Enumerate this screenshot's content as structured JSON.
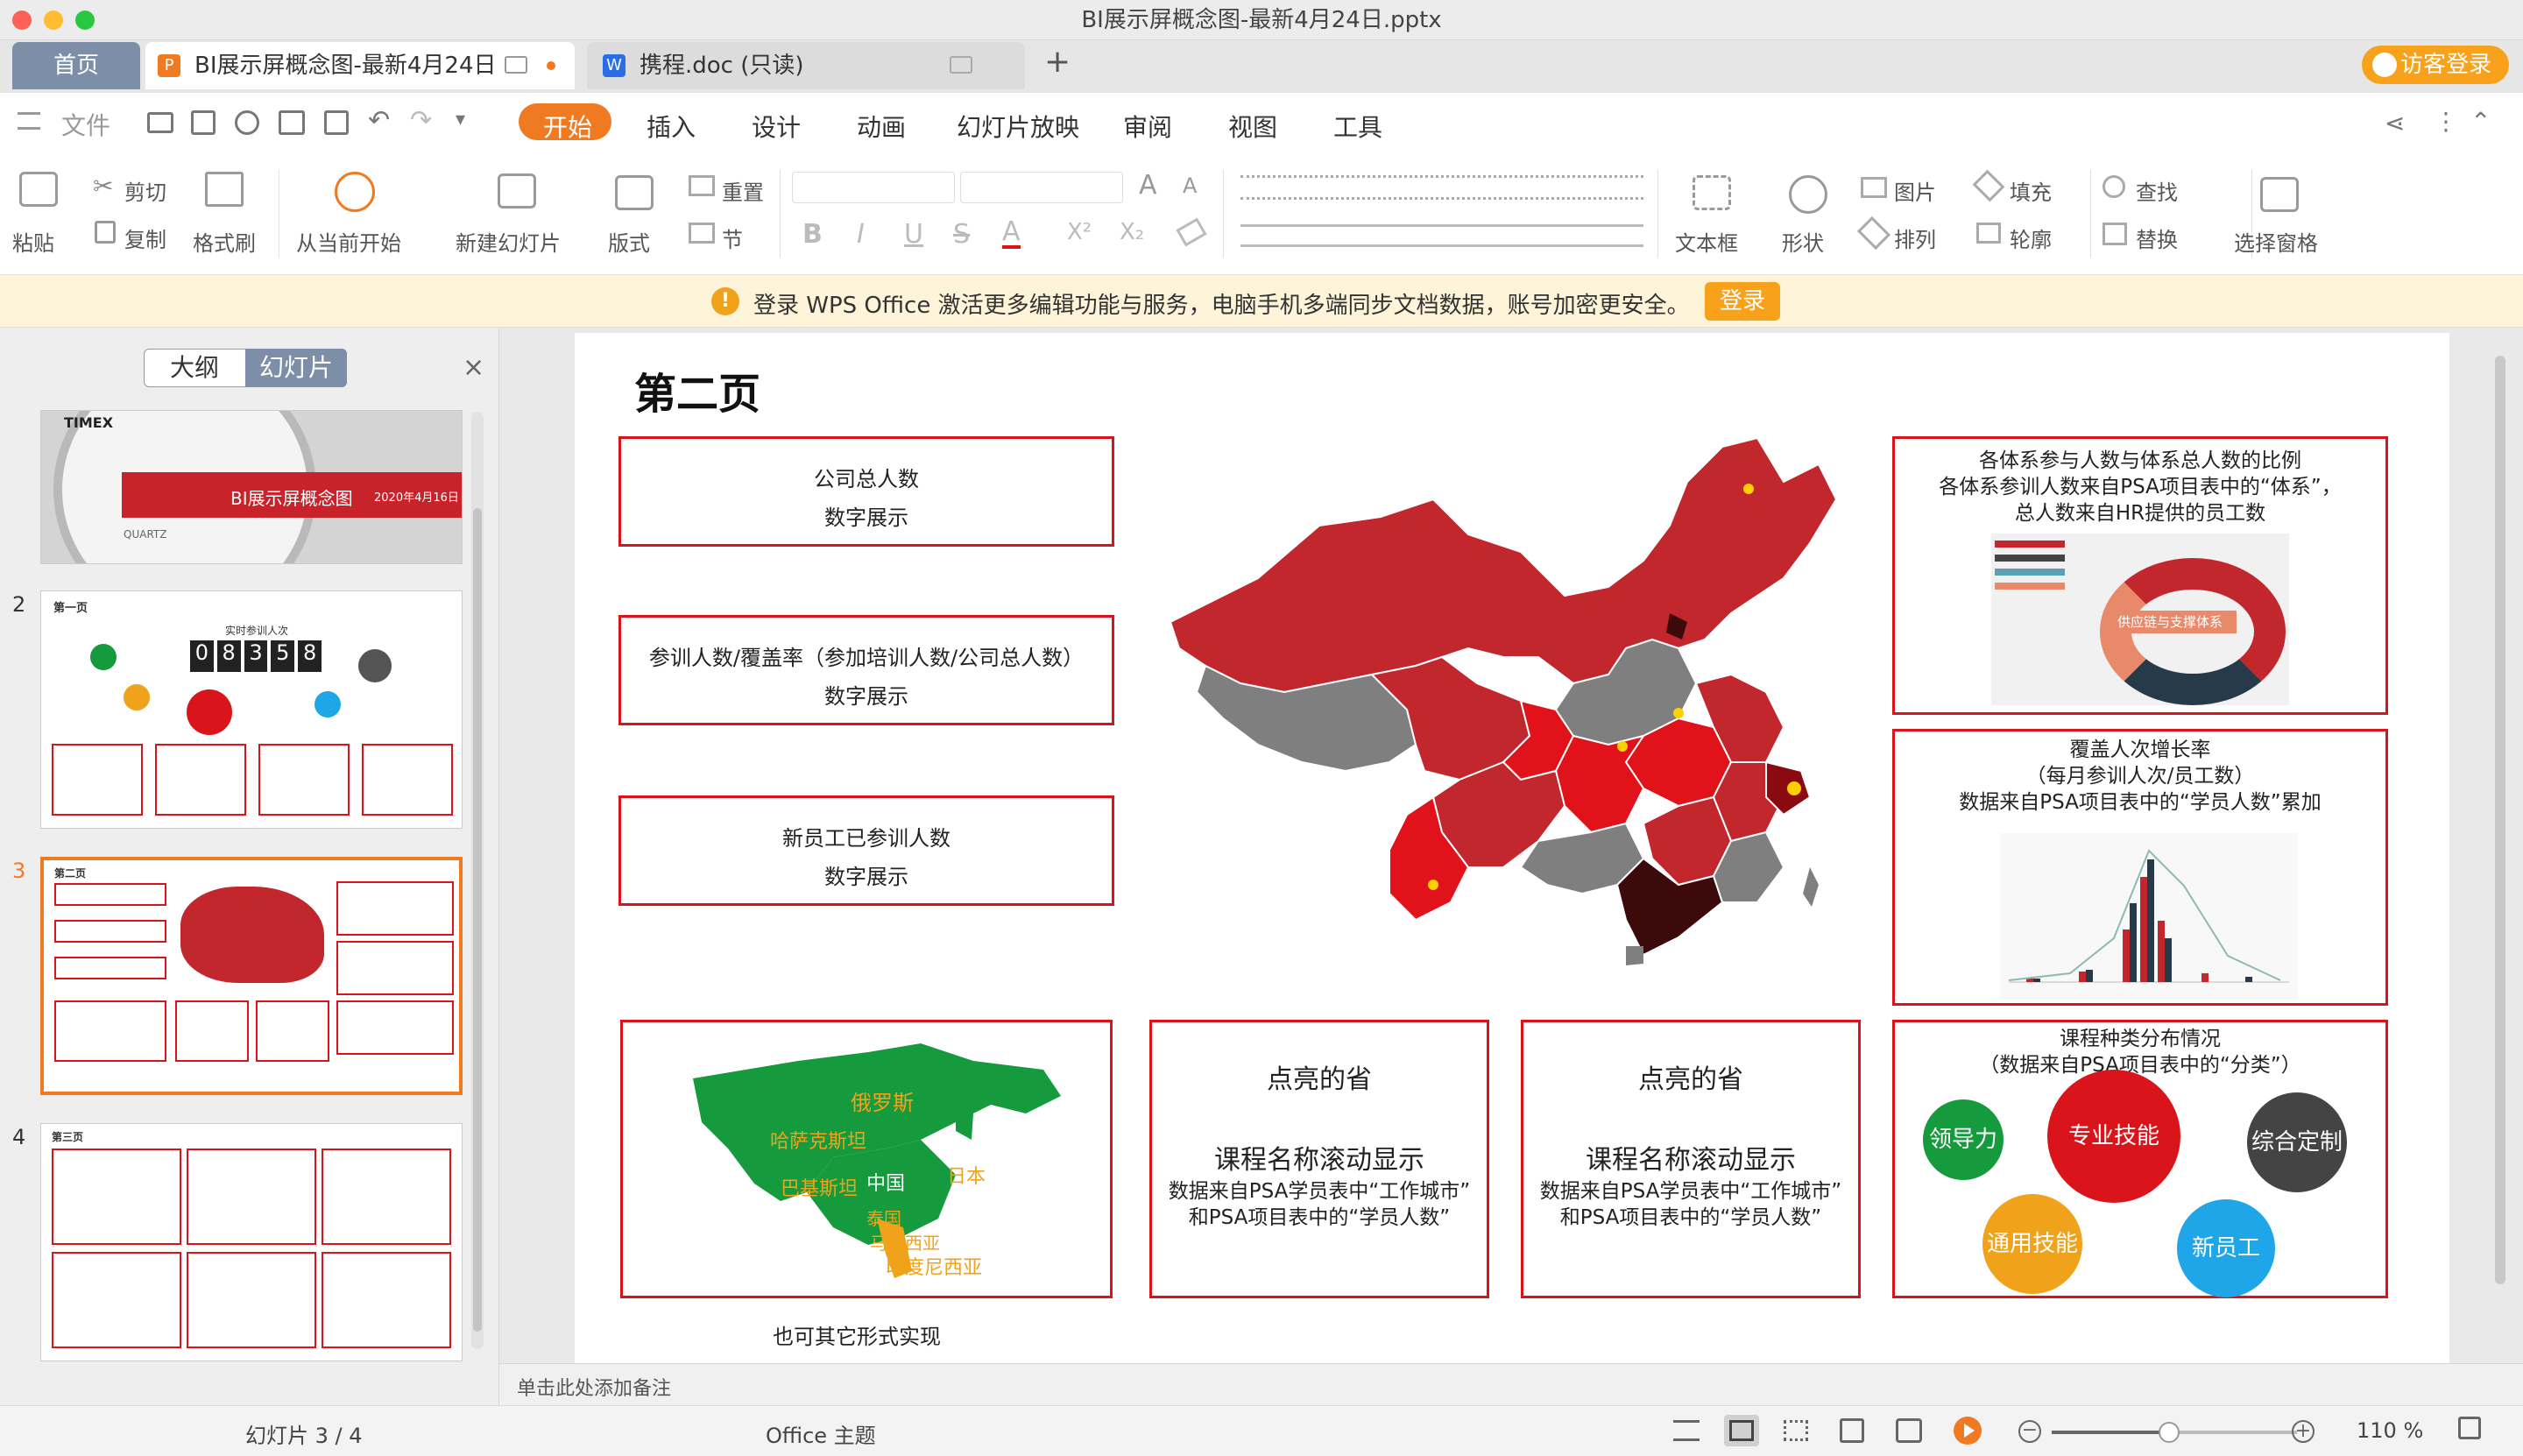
{
  "window": {
    "title": "BI展示屏概念图-最新4月24日.pptx"
  },
  "tabs": {
    "home": "首页",
    "doc1": "BI展示屏概念图-最新4月24日",
    "doc2": "携程.doc (只读)",
    "add": "+",
    "guest": "访客登录"
  },
  "ribbon": {
    "menu": "文件",
    "tabs": [
      "开始",
      "插入",
      "设计",
      "动画",
      "幻灯片放映",
      "审阅",
      "视图",
      "工具"
    ]
  },
  "toolbar": {
    "paste": "粘贴",
    "cut": "剪切",
    "copy": "复制",
    "format_painter": "格式刷",
    "from_current": "从当前开始",
    "new_slide": "新建幻灯片",
    "layout": "版式",
    "reset": "重置",
    "section": "节",
    "textbox": "文本框",
    "shape": "形状",
    "picture": "图片",
    "arrange": "排列",
    "fill": "填充",
    "outline": "轮廓",
    "find": "查找",
    "replace": "替换",
    "select_pane": "选择窗格"
  },
  "banner": {
    "text": "登录 WPS Office 激活更多编辑功能与服务，电脑手机多端同步文档数据，账号加密更安全。",
    "button": "登录"
  },
  "left_panel": {
    "tab_outline": "大纲",
    "tab_slides": "幻灯片",
    "close": "×",
    "slide_numbers": [
      "2",
      "3",
      "4"
    ],
    "slide1": {
      "brand": "TIMEX",
      "title": "BI展示屏概念图",
      "date": "2020年4月16日",
      "sub": "QUARTZ"
    },
    "slide2": {
      "title": "第一页",
      "caption": "实时参训人次",
      "digits": [
        "0",
        "8",
        "3",
        "5",
        "8"
      ]
    },
    "slide3": {
      "title": "第二页"
    },
    "slide4": {
      "title": "第三页"
    }
  },
  "slide": {
    "title": "第二页",
    "box1": {
      "line1": "公司总人数",
      "line2": "数字展示"
    },
    "box2": {
      "line1": "参训人数/覆盖率（参加培训人数/公司总人数）",
      "line2": "数字展示"
    },
    "box3": {
      "line1": "新员工已参训人数",
      "line2": "数字展示"
    },
    "box_ratio": {
      "l1": "各体系参与人数与体系总人数的比例",
      "l2": "各体系参训人数来自PSA项目表中的“体系”，",
      "l3": "总人数来自HR提供的员工数",
      "donut_label": "供应链与支撑体系"
    },
    "box_growth": {
      "l1": "覆盖人次增长率",
      "l2": "（每月参训人次/员工数）",
      "l3": "数据来自PSA项目表中的“学员人数”累加"
    },
    "box_courses": {
      "l1": "课程种类分布情况",
      "l2": "（数据来自PSA项目表中的“分类”）"
    },
    "bubbles": [
      "领导力",
      "专业技能",
      "综合定制",
      "通用技能",
      "新员工"
    ],
    "asia": {
      "labels": [
        "俄罗斯",
        "哈萨克斯坦",
        "巴基斯坦",
        "中国",
        "日本",
        "泰国",
        "马来西亚",
        "印度尼西亚"
      ],
      "caption": "也可其它形式实现"
    },
    "prov1": {
      "title": "点亮的省",
      "l1": "课程名称滚动显示",
      "l2": "数据来自PSA学员表中“工作城市”",
      "l3": "和PSA项目表中的“学员人数”"
    },
    "prov2": {
      "title": "点亮的省",
      "l1": "课程名称滚动显示",
      "l2": "数据来自PSA学员表中“工作城市”",
      "l3": "和PSA项目表中的“学员人数”"
    }
  },
  "notes": "单击此处添加备注",
  "status": {
    "slide_counter": "幻灯片 3 / 4",
    "theme": "Office 主题",
    "zoom": "110 %"
  },
  "colors": {
    "accent_orange": "#f07a22",
    "red": "#d9141b",
    "map_red": "#c1272d",
    "map_gray": "#7f7f7f",
    "green": "#159a3e"
  }
}
